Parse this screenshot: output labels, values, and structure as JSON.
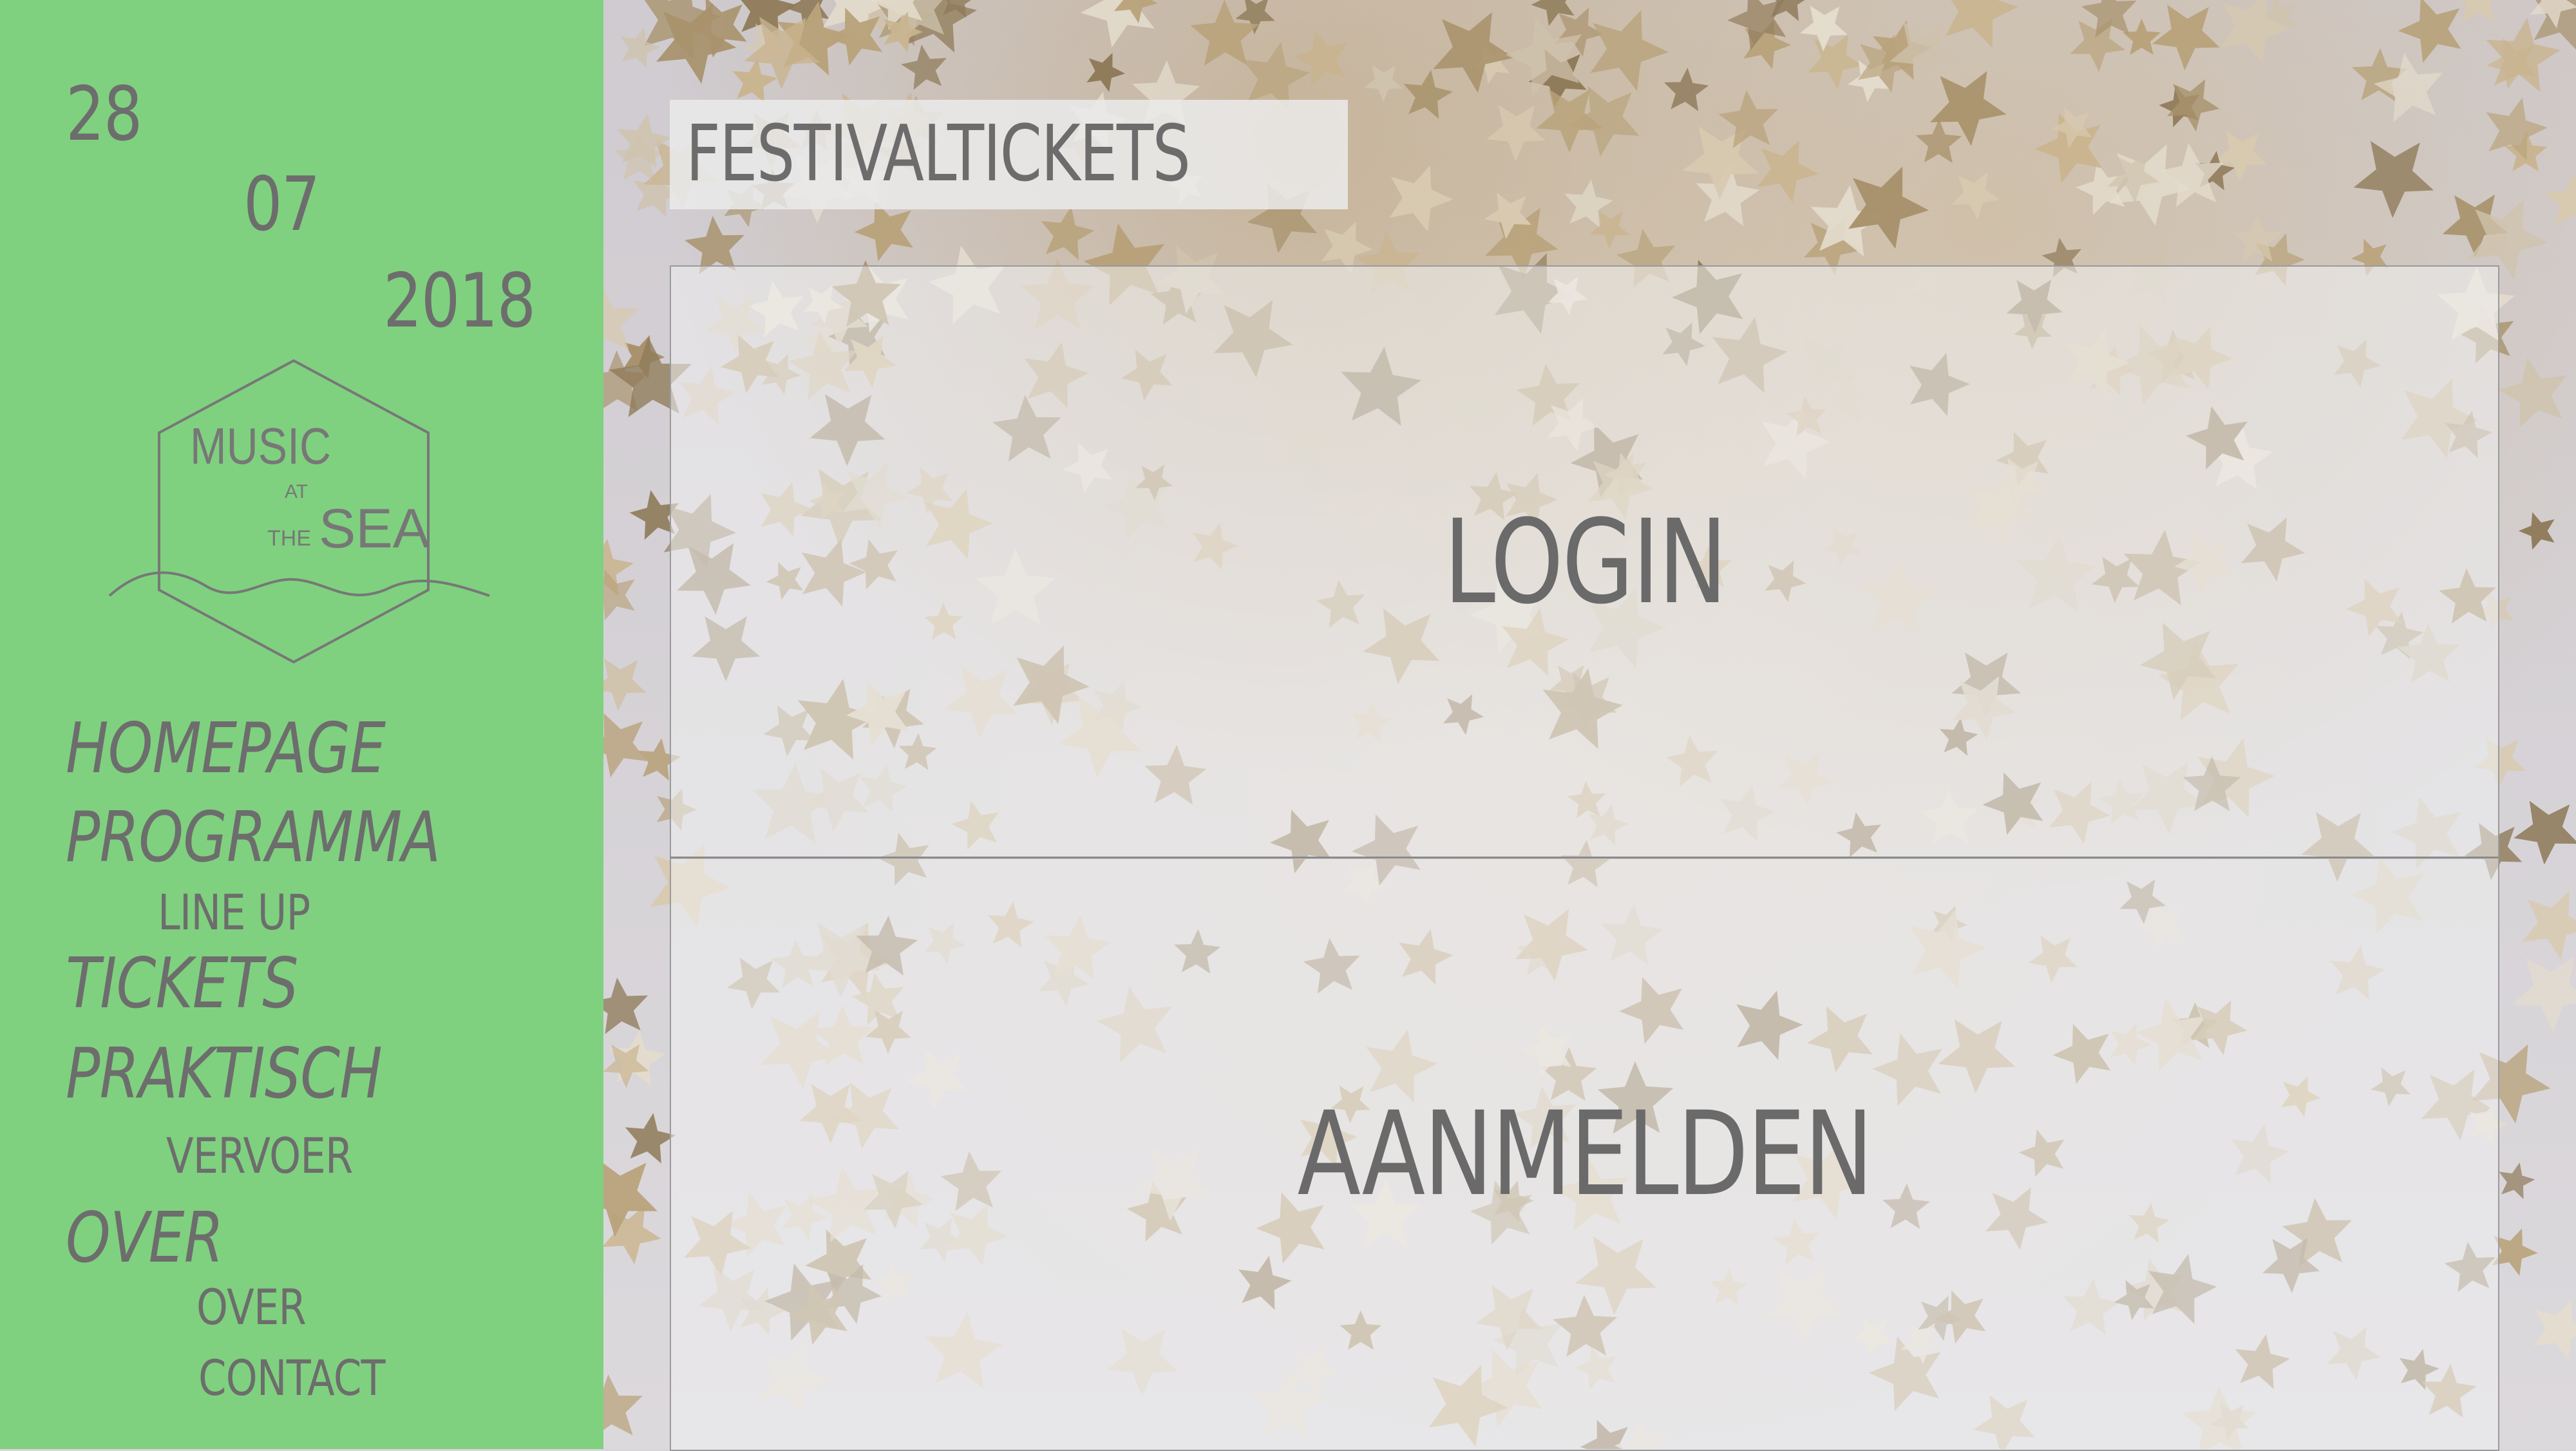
{
  "date": {
    "day": "28",
    "month": "07",
    "year": "2018"
  },
  "logo": {
    "line1": "MUSIC",
    "at": "AT",
    "the": "THE",
    "sea": "SEA"
  },
  "nav": {
    "homepage": "HOMEPAGE",
    "programma": "PROGRAMMA",
    "lineup": "LINE UP",
    "tickets": "TICKETS",
    "praktisch": "PRAKTISCH",
    "vervoer": "VERVOER",
    "over": "OVER",
    "over_sub": "OVER",
    "contact": "CONTACT"
  },
  "main": {
    "title": "FESTIVALTICKETS",
    "login_label": "LOGIN",
    "register_label": "AANMELDEN"
  },
  "colors": {
    "sidebar": "#7fd17f",
    "text": "#6d6d6d"
  }
}
